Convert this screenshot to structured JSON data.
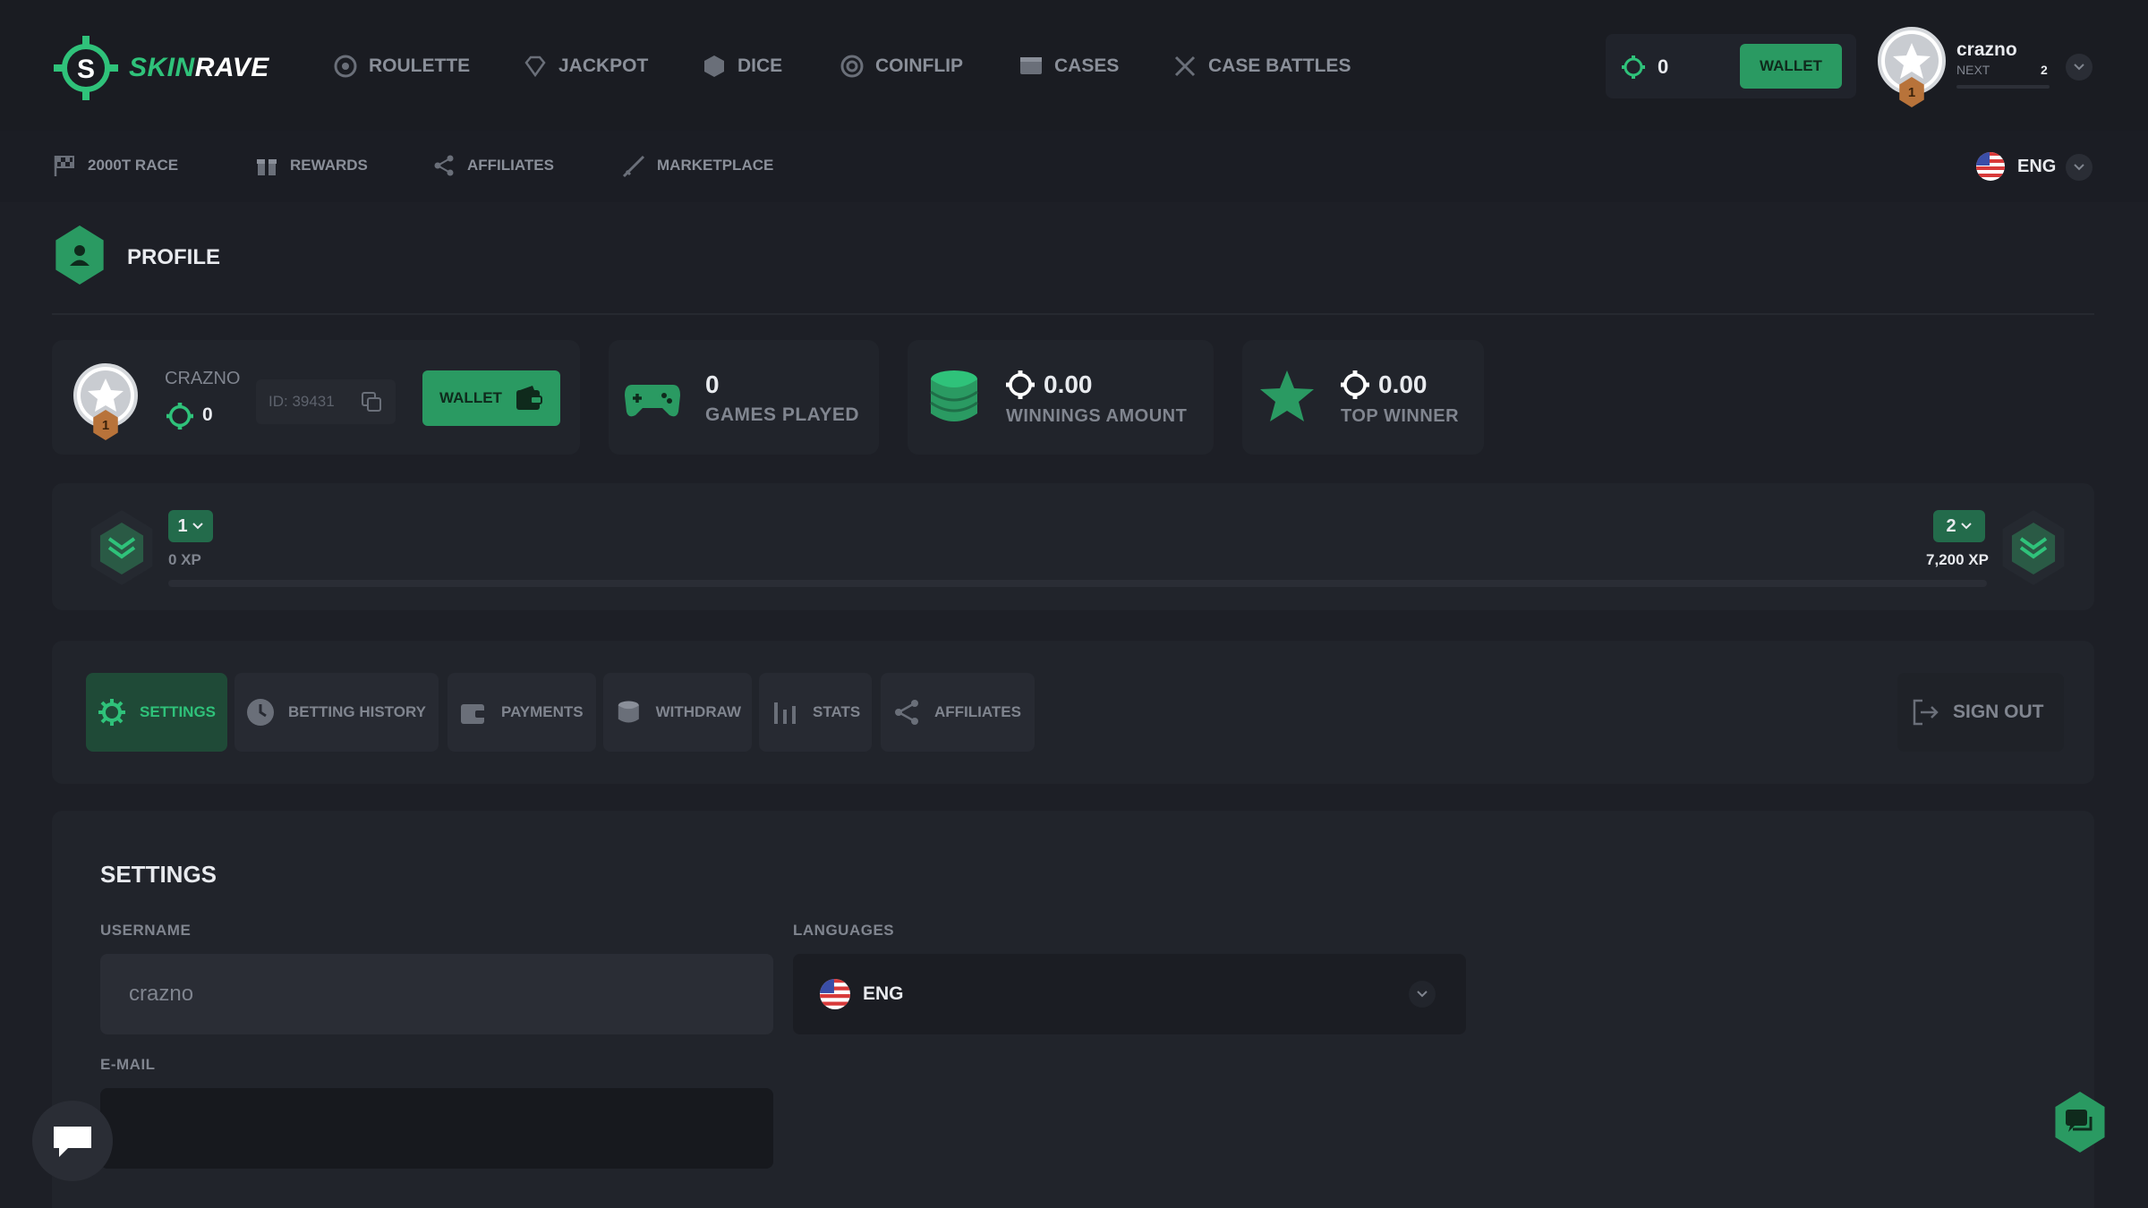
{
  "brand": {
    "part1": "SKIN",
    "part2": "RAVE"
  },
  "nav": [
    {
      "label": "ROULETTE",
      "icon": "roulette-icon"
    },
    {
      "label": "JACKPOT",
      "icon": "diamond-icon"
    },
    {
      "label": "DICE",
      "icon": "dice-icon"
    },
    {
      "label": "COINFLIP",
      "icon": "coin-icon"
    },
    {
      "label": "CASES",
      "icon": "case-icon"
    },
    {
      "label": "CASE BATTLES",
      "icon": "swords-icon"
    }
  ],
  "header": {
    "balance": "0",
    "wallet_label": "WALLET",
    "username": "crazno",
    "next_label": "NEXT",
    "next_level": "2",
    "level_badge": "1"
  },
  "subnav": [
    {
      "label": "2000T RACE",
      "icon": "flag-icon"
    },
    {
      "label": "REWARDS",
      "icon": "gift-icon"
    },
    {
      "label": "AFFILIATES",
      "icon": "share-icon"
    },
    {
      "label": "MARKETPLACE",
      "icon": "rifle-icon"
    }
  ],
  "language": {
    "code": "ENG"
  },
  "page": {
    "title": "PROFILE"
  },
  "profile": {
    "name": "CRAZNO",
    "balance": "0",
    "id": "ID: 39431",
    "wallet_label": "WALLET",
    "level_badge": "1"
  },
  "stats": [
    {
      "value": "0",
      "label": "GAMES PLAYED",
      "coin": false,
      "icon": "gamepad-icon"
    },
    {
      "value": "0.00",
      "label": "WINNINGS AMOUNT",
      "coin": true,
      "icon": "coins-stack-icon"
    },
    {
      "value": "0.00",
      "label": "TOP WINNER",
      "coin": true,
      "icon": "star-icon"
    }
  ],
  "progress": {
    "current_level": "1",
    "current_xp": "0 XP",
    "next_level": "2",
    "next_xp": "7,200 XP",
    "fraction": 0
  },
  "tabs": [
    {
      "label": "SETTINGS",
      "icon": "gear-icon",
      "active": true
    },
    {
      "label": "BETTING HISTORY",
      "icon": "clock-icon",
      "active": false
    },
    {
      "label": "PAYMENTS",
      "icon": "wallet-icon",
      "active": false
    },
    {
      "label": "WITHDRAW",
      "icon": "coins-icon",
      "active": false
    },
    {
      "label": "STATS",
      "icon": "bars-icon",
      "active": false
    },
    {
      "label": "AFFILIATES",
      "icon": "share-icon",
      "active": false
    }
  ],
  "signout_label": "SIGN OUT",
  "settings": {
    "title": "SETTINGS",
    "username_label": "USERNAME",
    "username_value": "crazno",
    "languages_label": "LANGUAGES",
    "language_value": "ENG",
    "email_label": "E-MAIL",
    "email_value": ""
  },
  "colors": {
    "accent": "#2fc27a",
    "bg": "#1d1f26",
    "card": "#21242b",
    "bronze": "#b8733a"
  }
}
